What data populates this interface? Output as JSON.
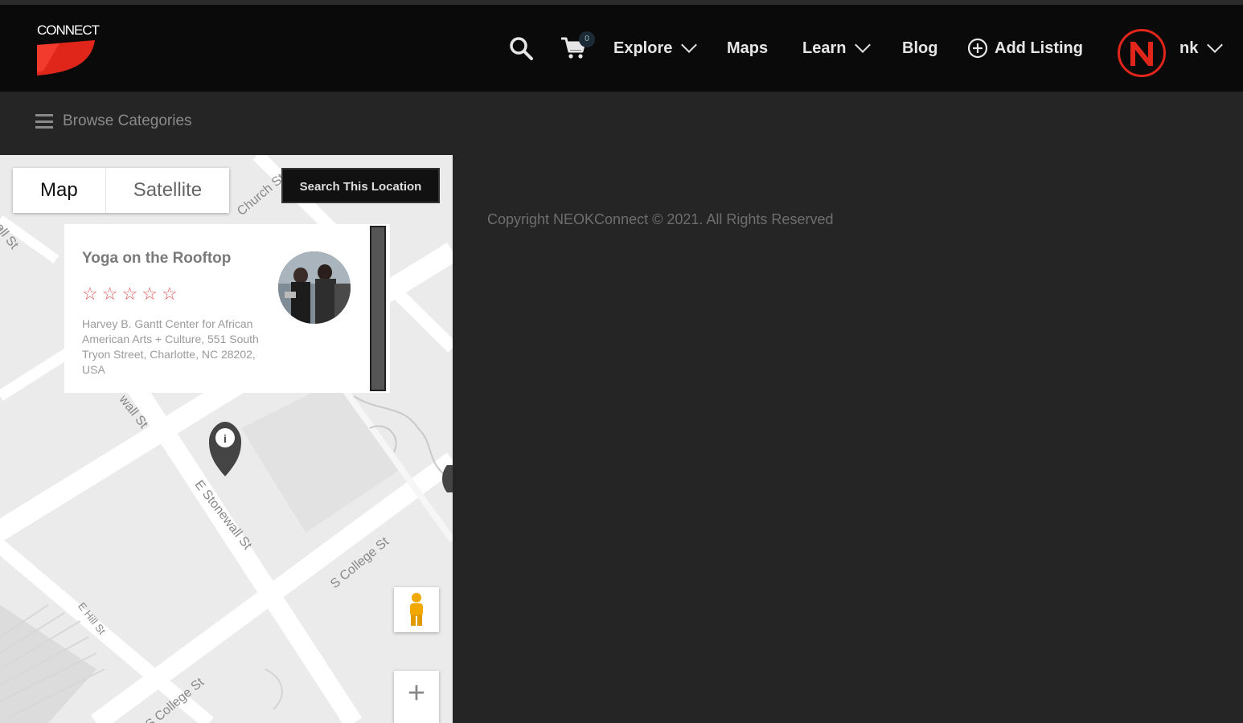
{
  "header": {
    "logo_text": "CONNECT",
    "cart_count": "0",
    "nav": {
      "explore": "Explore",
      "maps": "Maps",
      "learn": "Learn",
      "blog": "Blog",
      "add_listing": "Add Listing"
    },
    "user": {
      "avatar_letter": "N",
      "name": "nk"
    }
  },
  "subbar": {
    "browse_label": "Browse Categories"
  },
  "map": {
    "tabs": {
      "map": "Map",
      "satellite": "Satellite"
    },
    "search_button": "Search This Location",
    "zoom_in": "+",
    "streets": {
      "church": "Church St",
      "stonewall_top": "wall St",
      "stonewall": "E Stonewall St",
      "college_right": "S College St",
      "college_bottom": "S College St",
      "hill": "E Hill St",
      "left_st": "all St"
    },
    "card": {
      "title": "Yoga on the Rooftop",
      "rating": 0,
      "rating_max": 5,
      "address": "Harvey B. Gantt Center for African American Arts + Culture, 551 South Tryon Street, Charlotte, NC 28202, USA"
    }
  },
  "footer": {
    "copyright": "Copyright NEOKConnect © 2021. All Rights Reserved"
  },
  "colors": {
    "accent": "#e0261b",
    "header_bg": "#0a0a0a",
    "page_bg": "#252525",
    "star": "#e05a5a"
  }
}
